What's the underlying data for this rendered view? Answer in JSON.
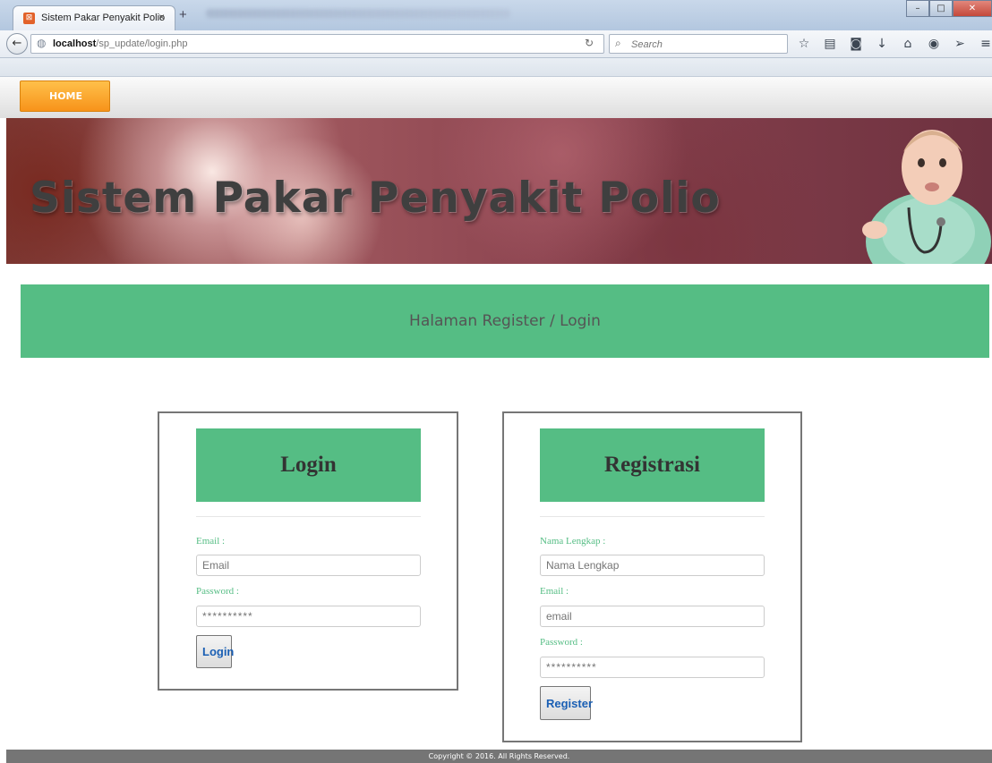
{
  "browser": {
    "tab_title": "Sistem Pakar Penyakit Polio",
    "tab_close": "×",
    "new_tab": "+",
    "url_host": "localhost",
    "url_path": "/sp_update/login.php",
    "search_placeholder": "Search",
    "icons": [
      "star-icon",
      "reader-icon",
      "pocket-icon",
      "download-icon",
      "home-icon",
      "chat-icon",
      "send-icon",
      "menu-icon"
    ],
    "icon_glyphs": [
      "☆",
      "▤",
      "◙",
      "↓",
      "⌂",
      "◉",
      "➢",
      "≡"
    ]
  },
  "nav": {
    "home_label": "HOME"
  },
  "banner": {
    "title": "Sistem Pakar Penyakit Polio"
  },
  "subheader": {
    "text": "Halaman Register / Login"
  },
  "login": {
    "heading": "Login",
    "email_label": "Email :",
    "email_placeholder": "Email",
    "password_label": "Password :",
    "password_value": "**********",
    "button": "Login"
  },
  "register": {
    "heading": "Registrasi",
    "name_label": "Nama Lengkap :",
    "name_placeholder": "Nama Lengkap",
    "email_label": "Email :",
    "email_placeholder": "email",
    "password_label": "Password :",
    "password_value": "**********",
    "button": "Register"
  },
  "footer": {
    "text": "Copyright © 2016. All Rights Reserved."
  },
  "colors": {
    "accent_green": "#55bd84",
    "home_orange": "#f7931a",
    "footer_gray": "#757575"
  }
}
